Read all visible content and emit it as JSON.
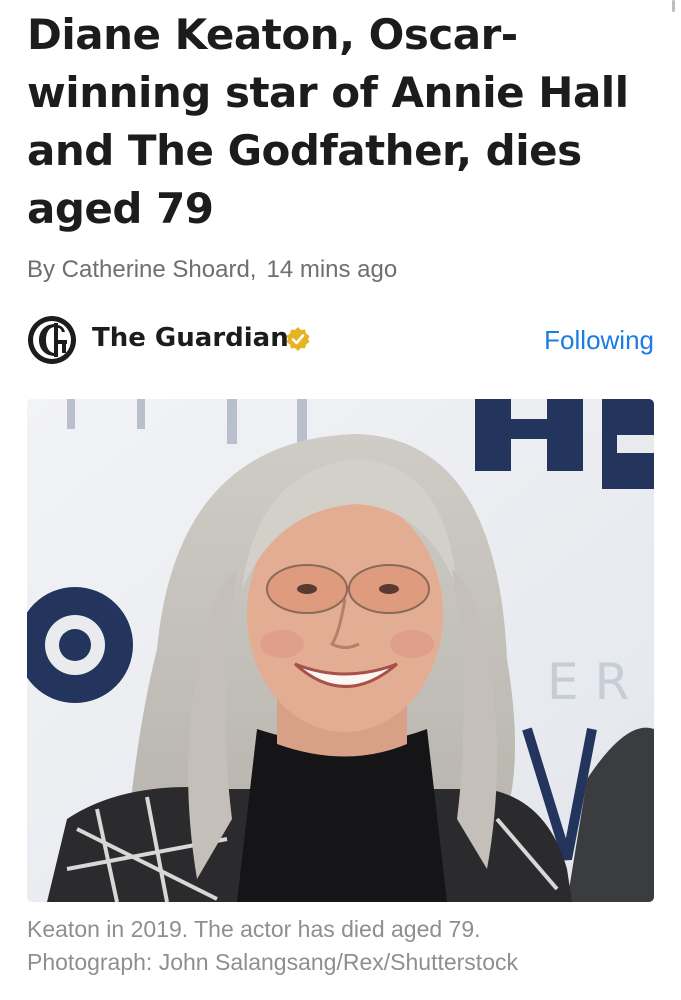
{
  "article": {
    "headline": "Diane Keaton, Oscar-winning star of Annie Hall and The Godfather, dies aged 79",
    "byline_author": "By Catherine Shoard,",
    "byline_time": "14 mins ago",
    "caption_line1": "Keaton in 2019. The actor has died aged 79.",
    "caption_line2": "Photograph: John Salangsang/Rex/Shutterstock"
  },
  "publisher": {
    "name": "The Guardian",
    "logo_icon": "guardian-g-logo",
    "verified_icon": "verified-badge-icon",
    "follow_label": "Following"
  },
  "photo": {
    "subject": "woman-with-long-grey-hair-and-tinted-glasses",
    "backdrop_text": "HB"
  },
  "colors": {
    "headline": "#1c1c1e",
    "byline": "#6e6e73",
    "caption": "#8e8e93",
    "follow_blue": "#1a7ce4",
    "verified_gold": "#e6b422",
    "backdrop_navy": "#23355d"
  }
}
